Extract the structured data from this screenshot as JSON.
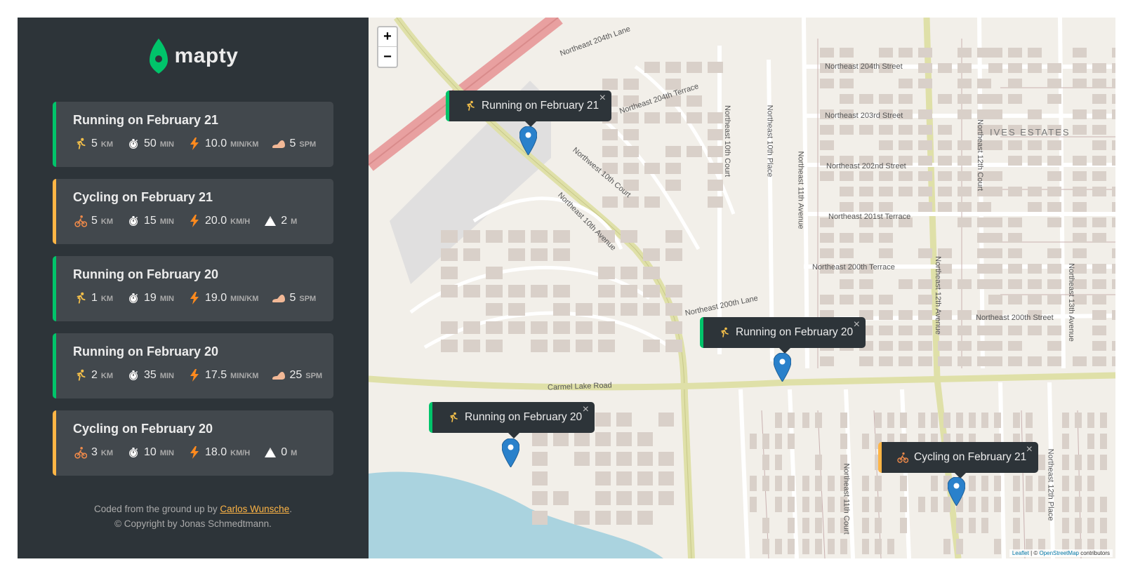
{
  "app": {
    "logo_text": "mapty",
    "brand_green": "#00c46a",
    "brand_yellow": "#ffb545",
    "sidebar_bg": "#2d3439",
    "card_bg": "#42484d"
  },
  "workouts": [
    {
      "type": "running",
      "title": "Running on February 21",
      "type_icon": "runner-icon",
      "distance": "5",
      "distance_unit": "km",
      "duration": "50",
      "duration_unit": "min",
      "speed": "10.0",
      "speed_unit": "min/km",
      "extra_icon": "footprint-icon",
      "extra": "5",
      "extra_unit": "spm"
    },
    {
      "type": "cycling",
      "title": "Cycling on February 21",
      "type_icon": "cyclist-icon",
      "distance": "5",
      "distance_unit": "km",
      "duration": "15",
      "duration_unit": "min",
      "speed": "20.0",
      "speed_unit": "km/h",
      "extra_icon": "mountain-icon",
      "extra": "2",
      "extra_unit": "m"
    },
    {
      "type": "running",
      "title": "Running on February 20",
      "type_icon": "runner-icon",
      "distance": "1",
      "distance_unit": "km",
      "duration": "19",
      "duration_unit": "min",
      "speed": "19.0",
      "speed_unit": "min/km",
      "extra_icon": "footprint-icon",
      "extra": "5",
      "extra_unit": "spm"
    },
    {
      "type": "running",
      "title": "Running on February 20",
      "type_icon": "runner-icon",
      "distance": "2",
      "distance_unit": "km",
      "duration": "35",
      "duration_unit": "min",
      "speed": "17.5",
      "speed_unit": "min/km",
      "extra_icon": "footprint-icon",
      "extra": "25",
      "extra_unit": "spm"
    },
    {
      "type": "cycling",
      "title": "Cycling on February 20",
      "type_icon": "cyclist-icon",
      "distance": "3",
      "distance_unit": "km",
      "duration": "10",
      "duration_unit": "min",
      "speed": "18.0",
      "speed_unit": "km/h",
      "extra_icon": "mountain-icon",
      "extra": "0",
      "extra_unit": "m"
    }
  ],
  "footer": {
    "prefix": "Coded from the ground up by ",
    "author_link": "Carlos Wunsche",
    "suffix": ".",
    "copyright": "© Copyright by Jonas Schmedtmann."
  },
  "map": {
    "zoom_in": "+",
    "zoom_out": "−",
    "popups": [
      {
        "type": "running",
        "label": "Running on February 21",
        "close": "×"
      },
      {
        "type": "running",
        "label": "Running on February 20",
        "close": "×"
      },
      {
        "type": "running",
        "label": "Running on February 20",
        "close": "×"
      },
      {
        "type": "cycling",
        "label": "Cycling on February 21",
        "close": "×"
      }
    ],
    "street_labels": [
      "Northeast 204th Lane",
      "Northeast 204th Terrace",
      "Northeast 204th Street",
      "Northeast 203rd Street",
      "Northeast 202nd Street",
      "Northeast 201st Terrace",
      "Northeast 200th Terrace",
      "Northeast 200th Lane",
      "Northeast 200th Street",
      "Carmel Lake Road",
      "Northwest 10th Court",
      "Northeast 10th Avenue",
      "Northeast 10th Court",
      "Northeast 10th Place",
      "Northeast 11th Avenue",
      "Northeast 11th Court",
      "Northeast 12th Avenue",
      "Northeast 12th Court",
      "Northeast 12th Place",
      "Northeast 13th Avenue",
      "IVES ESTATES"
    ],
    "attribution_leaflet": "Leaflet",
    "attribution_sep": " | © ",
    "attribution_osm": "OpenStreetMap",
    "attribution_suffix": " contributors"
  }
}
